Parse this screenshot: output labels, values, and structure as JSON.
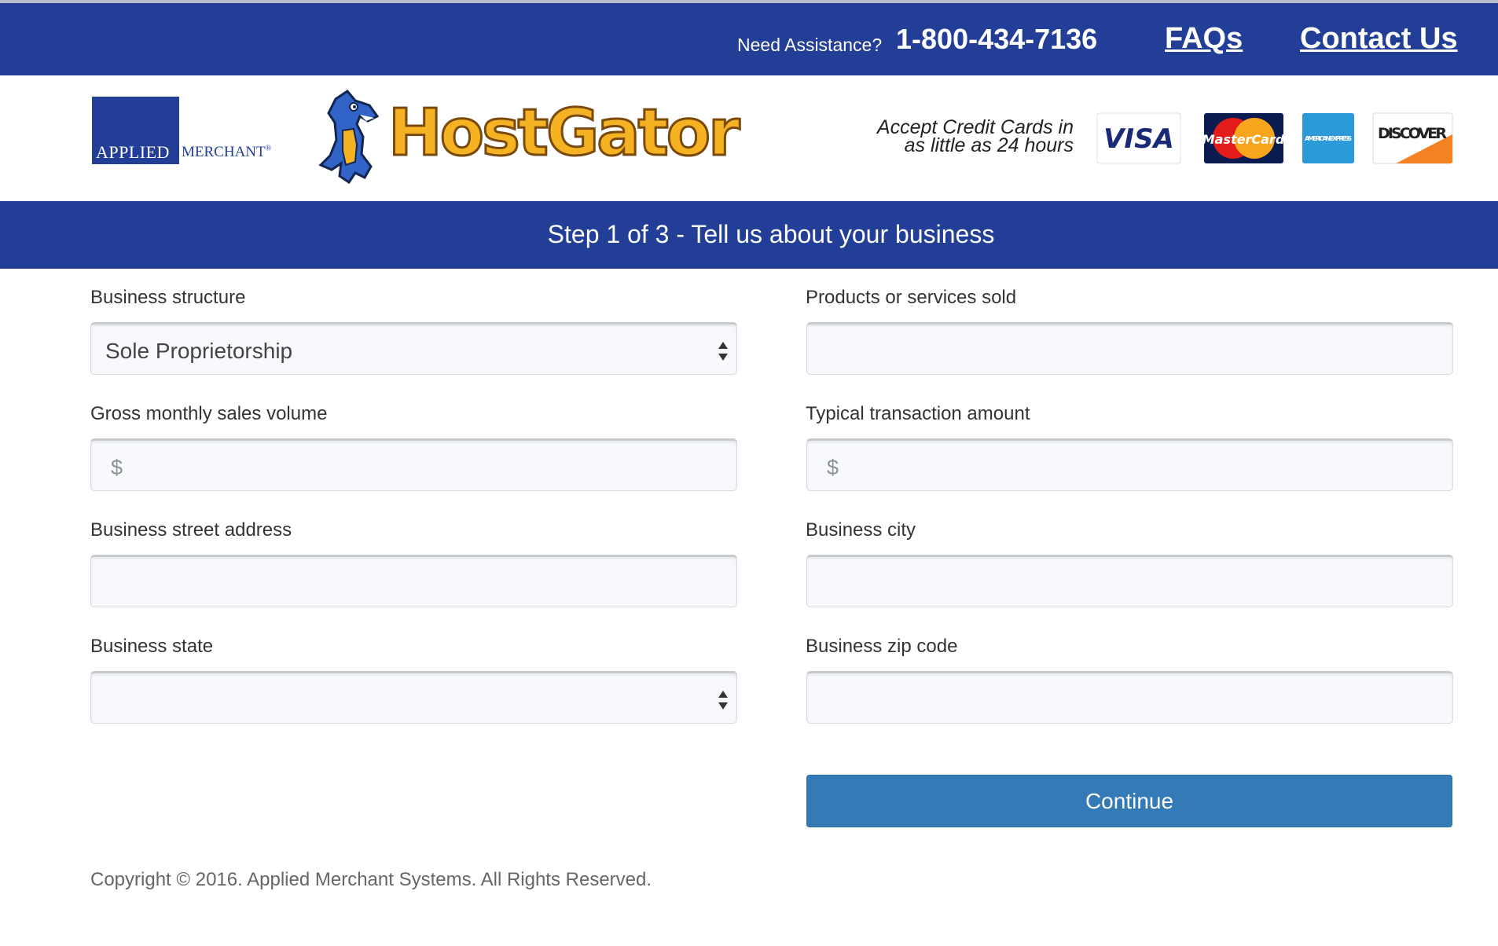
{
  "top_bar": {
    "assist_label": "Need Assistance?",
    "phone": "1-800-434-7136",
    "faqs_label": "FAQs",
    "contact_label": "Contact Us"
  },
  "header": {
    "applied_merchant_word1": "APPLIED",
    "applied_merchant_word2": "MERCHANT",
    "hostgator_logo_text": "HostGator",
    "accept_line1": "Accept Credit Cards in",
    "accept_line2": "as little as 24 hours",
    "cards": [
      "VISA",
      "MasterCard",
      "AMERICAN EXPRESS",
      "DISCOVER"
    ]
  },
  "step_bar": {
    "title": "Step 1 of 3 - Tell us about your business"
  },
  "form": {
    "business_structure": {
      "label": "Business structure",
      "value": "Sole Proprietorship"
    },
    "products_sold": {
      "label": "Products or services sold",
      "value": ""
    },
    "gross_monthly": {
      "label": "Gross monthly sales volume",
      "prefix": "$",
      "value": ""
    },
    "typical_transaction": {
      "label": "Typical transaction amount",
      "prefix": "$",
      "value": ""
    },
    "street_address": {
      "label": "Business street address",
      "value": ""
    },
    "city": {
      "label": "Business city",
      "value": ""
    },
    "state": {
      "label": "Business state",
      "value": ""
    },
    "zip": {
      "label": "Business zip code",
      "value": ""
    },
    "continue_label": "Continue"
  },
  "footer": {
    "copyright": "Copyright © 2016. Applied Merchant Systems. All Rights Reserved."
  },
  "colors": {
    "brand_blue": "#233e96",
    "button_blue": "#337ab7",
    "hostgator_gold": "#f5b324"
  }
}
